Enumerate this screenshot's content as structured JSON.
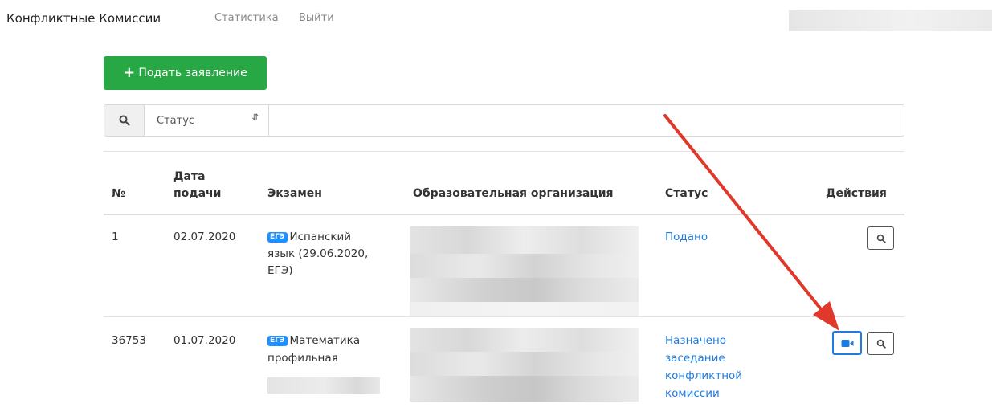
{
  "navbar": {
    "brand": "Конфликтные Комиссии",
    "links": [
      "Статистика",
      "Выйти"
    ]
  },
  "toolbar": {
    "add_label": "Подать заявление"
  },
  "filter": {
    "status_select": "Статус"
  },
  "table": {
    "headers": {
      "number": "№",
      "date_line1": "Дата",
      "date_line2": "подачи",
      "exam": "Экзамен",
      "org": "Образовательная организация",
      "status": "Статус",
      "actions": "Действия"
    },
    "rows": [
      {
        "number": "1",
        "date": "02.07.2020",
        "exam_badge": "ЕГЭ",
        "exam_lines": [
          "Испанский",
          "язык (29.06.2020,",
          "ЕГЭ)"
        ],
        "status_lines": [
          "Подано"
        ]
      },
      {
        "number": "36753",
        "date": "01.07.2020",
        "exam_badge": "ЕГЭ",
        "exam_lines": [
          "Математика",
          "профильная"
        ],
        "status_lines": [
          "Назначено",
          "заседание",
          "конфликтной",
          "комиссии"
        ]
      }
    ]
  },
  "colors": {
    "accent_green": "#28a745",
    "link_blue": "#1e7be0",
    "arrow_red": "#e0392b"
  },
  "icons": {
    "search": "search-icon",
    "video": "video-camera-icon",
    "plus": "plus-icon"
  }
}
